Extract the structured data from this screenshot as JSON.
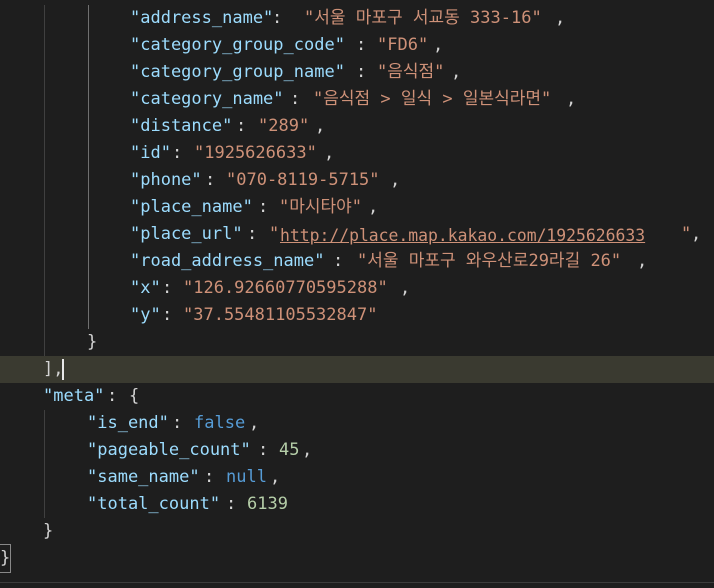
{
  "editor": {
    "lines": [
      {
        "key": "\"address_name\"",
        "sep": ": ",
        "value": "\"서울 마포구 서교동 333-16\"",
        "end": ","
      },
      {
        "key": "\"category_group_code\"",
        "sep": ": ",
        "value": "\"FD6\"",
        "end": ","
      },
      {
        "key": "\"category_group_name\"",
        "sep": ": ",
        "value": "\"음식점\"",
        "end": ","
      },
      {
        "key": "\"category_name\"",
        "sep": ": ",
        "value": "\"음식점 > 일식 > 일본식라면\"",
        "end": ","
      },
      {
        "key": "\"distance\"",
        "sep": ": ",
        "value": "\"289\"",
        "end": ","
      },
      {
        "key": "\"id\"",
        "sep": ": ",
        "value": "\"1925626633\"",
        "end": ","
      },
      {
        "key": "\"phone\"",
        "sep": ": ",
        "value": "\"070-8119-5715\"",
        "end": ","
      },
      {
        "key": "\"place_name\"",
        "sep": ": ",
        "value": "\"마시타야\"",
        "end": ","
      },
      {
        "key": "\"place_url\"",
        "sep": ": ",
        "q1": "\"",
        "url": "http://place.map.kakao.com/1925626633",
        "q2": "\"",
        "end": ","
      },
      {
        "key": "\"road_address_name\"",
        "sep": ": ",
        "value": "\"서울 마포구 와우산로29라길 26\"",
        "end": ","
      },
      {
        "key": "\"x\"",
        "sep": ": ",
        "value": "\"126.92660770595288\"",
        "end": ","
      },
      {
        "key": "\"y\"",
        "sep": ": ",
        "value": "\"37.55481105532847\""
      },
      {
        "punct": "}"
      },
      {
        "punct": "],"
      },
      {
        "key": "\"meta\"",
        "sep": ": ",
        "open": "{"
      },
      {
        "key": "\"is_end\"",
        "sep": ": ",
        "value": "false",
        "end": ","
      },
      {
        "key": "\"pageable_count\"",
        "sep": ": ",
        "value": "45",
        "end": ","
      },
      {
        "key": "\"same_name\"",
        "sep": ": ",
        "value": "null",
        "end": ","
      },
      {
        "key": "\"total_count\"",
        "sep": ": ",
        "value": "6139"
      },
      {
        "punct": "}"
      },
      {
        "punct": "}"
      }
    ]
  },
  "colors": {
    "background": "#1e1e1e",
    "key": "#9cdcfe",
    "string": "#ce9178",
    "number": "#b5cea8",
    "keyword": "#569cd6",
    "punctuation": "#d4d4d4",
    "current_line": "#3a3a30"
  }
}
